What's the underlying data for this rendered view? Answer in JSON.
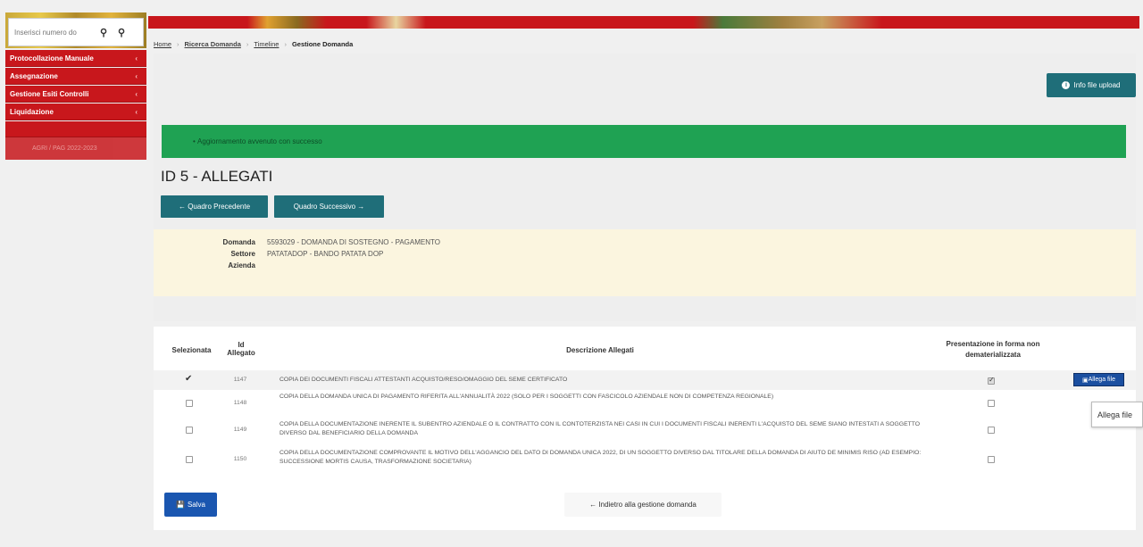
{
  "sidebar": {
    "search_placeholder": "Inserisci numero do",
    "items": [
      {
        "label": "Protocollazione Manuale"
      },
      {
        "label": "Assegnazione"
      },
      {
        "label": "Gestione Esiti Controlli"
      },
      {
        "label": "Liquidazione"
      }
    ],
    "footer": "AGRI / PAG 2022-2023"
  },
  "breadcrumb": {
    "items": [
      "Home",
      "Ricerca Domanda",
      "Timeline",
      "Gestione Domanda"
    ]
  },
  "info_button": "Info file upload",
  "alert": "Aggiornamento avvenuto con successo",
  "page_title": "ID 5 - ALLEGATI",
  "nav": {
    "prev": "Quadro Precedente",
    "next": "Quadro Successivo"
  },
  "info": {
    "domanda_label": "Domanda",
    "domanda_value": "5593029 - DOMANDA DI SOSTEGNO - PAGAMENTO",
    "settore_label": "Settore",
    "settore_value": "PATATADOP - BANDO PATATA DOP",
    "azienda_label": "Azienda",
    "azienda_value": ""
  },
  "table": {
    "headers": {
      "selezionata": "Selezionata",
      "id_line1": "Id",
      "id_line2": "Allegato",
      "descrizione": "Descrizione Allegati",
      "presentazione_line1": "Presentazione in forma non",
      "presentazione_line2": "dematerializzata"
    },
    "rows": [
      {
        "id": "1147",
        "selected": true,
        "presentazione": true,
        "desc": "COPIA DEI DOCUMENTI FISCALI ATTESTANTI ACQUISTO/RESO/OMAGGIO DEL SEME CERTIFICATO"
      },
      {
        "id": "1148",
        "selected": false,
        "presentazione": false,
        "desc": "COPIA DELLA DOMANDA UNICA DI PAGAMENTO RIFERITA ALL'ANNUALITÀ 2022 (SOLO PER I SOGGETTI CON FASCICOLO AZIENDALE NON DI COMPETENZA REGIONALE)"
      },
      {
        "id": "1149",
        "selected": false,
        "presentazione": false,
        "desc": "COPIA DELLA DOCUMENTAZIONE INERENTE IL SUBENTRO AZIENDALE O IL CONTRATTO CON IL CONTOTERZISTA NEI CASI IN CUI I DOCUMENTI FISCALI INERENTI L'ACQUISTO DEL SEME SIANO INTESTATI A SOGGETTO DIVERSO DAL BENEFICIARIO DELLA DOMANDA"
      },
      {
        "id": "1150",
        "selected": false,
        "presentazione": false,
        "desc": "COPIA DELLA DOCUMENTAZIONE COMPROVANTE IL MOTIVO DELL'AGGANCIO DEL DATO DI DOMANDA UNICA 2022, DI UN SOGGETTO DIVERSO DAL TITOLARE DELLA DOMANDA DI AIUTO DE MINIMIS RISO (AD ESEMPIO: SUCCESSIONE MORTIS CAUSA, TRASFORMAZIONE SOCIETARIA)"
      }
    ]
  },
  "allega_button": "Allega file",
  "tooltip": "Allega file",
  "save_button": "Salva",
  "back_button": "Indietro alla gestione domanda",
  "colors": {
    "primary_red": "#c8171c",
    "teal": "#1f6e79",
    "success_green": "#1fa253",
    "blue": "#1a56b0"
  }
}
